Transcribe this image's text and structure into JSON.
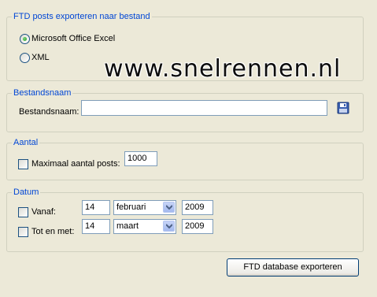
{
  "export_group": {
    "title": "FTD posts exporteren naar bestand",
    "options": [
      {
        "label": "Microsoft Office Excel",
        "selected": true
      },
      {
        "label": "XML",
        "selected": false
      }
    ]
  },
  "watermark": "www.snelrennen.nl",
  "filename_group": {
    "title": "Bestandsnaam",
    "label": "Bestandsnaam:",
    "value": "",
    "save_icon": "floppy-disk-icon"
  },
  "count_group": {
    "title": "Aantal",
    "checkbox_label": "Maximaal aantal posts:",
    "checked": false,
    "value": "1000"
  },
  "date_group": {
    "title": "Datum",
    "from": {
      "label": "Vanaf:",
      "checked": false,
      "day": "14",
      "month": "februari",
      "year": "2009"
    },
    "to": {
      "label": "Tot en met:",
      "checked": false,
      "day": "14",
      "month": "maart",
      "year": "2009"
    }
  },
  "export_button": "FTD database exporteren"
}
